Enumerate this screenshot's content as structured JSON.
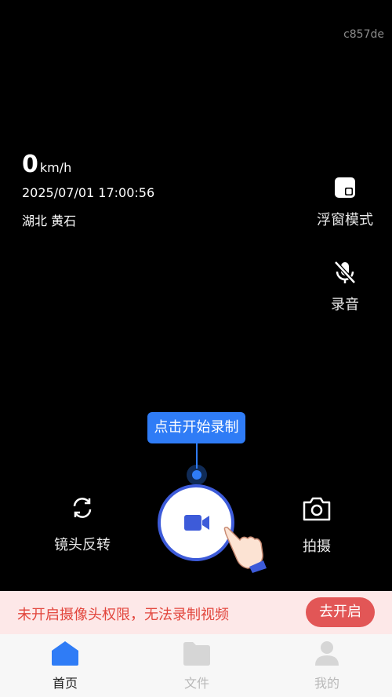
{
  "watermark": "c857de",
  "speed": {
    "value": "0",
    "unit": "km/h"
  },
  "datetime": "2025/07/01 17:00:56",
  "location": "湖北 黄石",
  "side_actions": {
    "float_label": "浮窗模式",
    "audio_label": "录音"
  },
  "tooltip": "点击开始录制",
  "controls": {
    "flip_label": "镜头反转",
    "photo_label": "拍摄"
  },
  "warning": {
    "text": "未开启摄像头权限，无法录制视频",
    "button": "去开启"
  },
  "tabs": [
    {
      "label": "首页",
      "icon": "home-icon",
      "active": true
    },
    {
      "label": "文件",
      "icon": "folder-icon",
      "active": false
    },
    {
      "label": "我的",
      "icon": "user-icon",
      "active": false
    }
  ],
  "colors": {
    "accent": "#2f7cf6",
    "record_ring": "#3d5bd9",
    "warning": "#e2453c",
    "warning_bg": "#fde8e8"
  }
}
